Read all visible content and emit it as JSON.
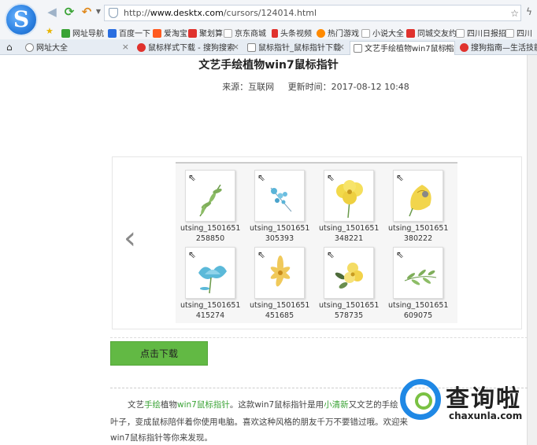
{
  "browser": {
    "url_prefix": "http://",
    "url_host": "www.desktx.com",
    "url_path": "/cursors/124014.html",
    "bookmarks": [
      "网址导航",
      "百度一下",
      "爱淘宝",
      "聚划算",
      "京东商城",
      "头条视频",
      "热门游戏",
      "小说大全",
      "同城交友约",
      "四川日报招",
      "四川"
    ],
    "tabs": [
      {
        "label": "网址大全",
        "active": false
      },
      {
        "label": "鼠标样式下载 - 搜狗搜索",
        "active": false
      },
      {
        "label": "鼠标指针_鼠标指针下载",
        "active": false
      },
      {
        "label": "文艺手绘植物win7鼠标指",
        "active": true
      },
      {
        "label": "搜狗指南—生活技能",
        "active": false
      }
    ]
  },
  "article": {
    "title": "文艺手绘植物win7鼠标指针",
    "source": "来源：互联网",
    "updated": "更新时间：2017-08-12 10:48"
  },
  "gallery": {
    "items": [
      {
        "name_line1": "utsing_1501651",
        "name_line2": "258850",
        "flower": "green-sprig"
      },
      {
        "name_line1": "utsing_1501651",
        "name_line2": "305393",
        "flower": "blue-blossom"
      },
      {
        "name_line1": "utsing_1501651",
        "name_line2": "348221",
        "flower": "yellow-flower"
      },
      {
        "name_line1": "utsing_1501651",
        "name_line2": "380222",
        "flower": "yellow-rose"
      },
      {
        "name_line1": "utsing_1501651",
        "name_line2": "415274",
        "flower": "blue-lotus"
      },
      {
        "name_line1": "utsing_1501651",
        "name_line2": "451685",
        "flower": "yellow-lily"
      },
      {
        "name_line1": "utsing_1501651",
        "name_line2": "578735",
        "flower": "yellow-daisy"
      },
      {
        "name_line1": "utsing_1501651",
        "name_line2": "609075",
        "flower": "green-leaves"
      }
    ]
  },
  "download": {
    "label": "点击下载"
  },
  "paragraph": {
    "p1_a": "文艺",
    "p1_link1": "手绘",
    "p1_b": "植物",
    "p1_link2": "win7鼠标指针",
    "p1_c": "。这款win7鼠标指针是用",
    "p1_link3": "小清新",
    "p1_d": "又文艺的手绘",
    "line2": "叶子，变成鼠标陪伴着你使用电脑。喜欢这种风格的朋友千万不要错过哦。欢迎来",
    "line3": "win7鼠标指针等你来发现。"
  },
  "watermark": {
    "text": "查询啦",
    "sub": "chaxunla.com"
  },
  "colors": {
    "accent_green": "#62b944",
    "link_green": "#3aa335",
    "watermark_blue": "#1f88e5"
  }
}
